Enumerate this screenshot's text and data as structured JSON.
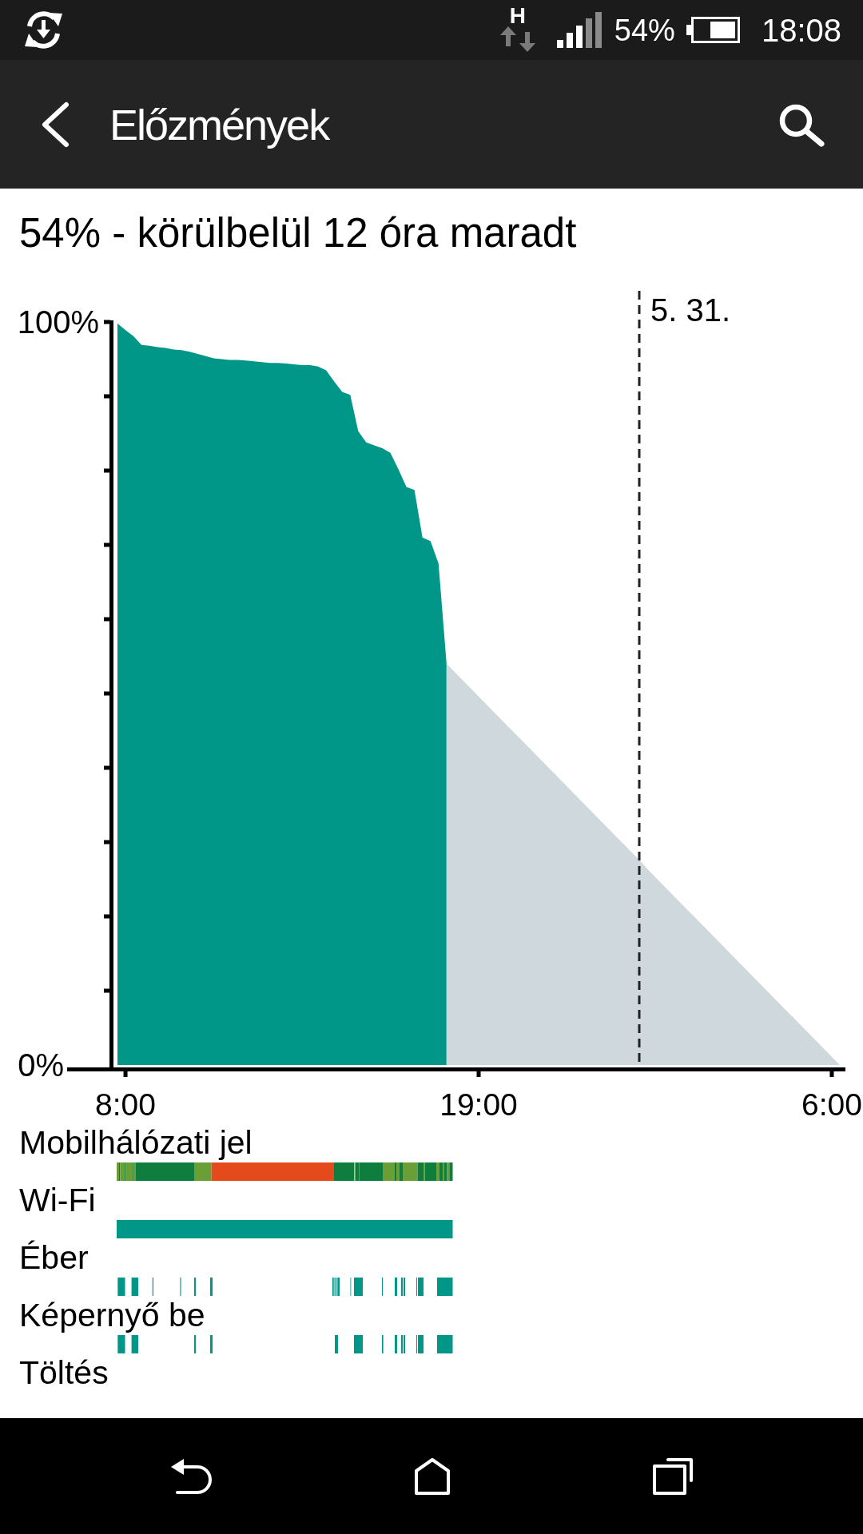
{
  "status_bar": {
    "network_type": "H",
    "battery": "54%",
    "time": "18:08"
  },
  "app_bar": {
    "title": "Előzmények"
  },
  "summary": "54% - körülbelül 12 óra maradt",
  "chart": {
    "chart_data": {
      "type": "area",
      "categories": [
        null,
        "8:00",
        null,
        null,
        null,
        null,
        null,
        null,
        null,
        null,
        null,
        null,
        null,
        null,
        null,
        null,
        null,
        null,
        null,
        null,
        null,
        null,
        null,
        null,
        null,
        null,
        null,
        null,
        null,
        null,
        null,
        null,
        null,
        null,
        null,
        null,
        null,
        null,
        null,
        null,
        null,
        null,
        null,
        null,
        null,
        "19:00",
        null,
        null,
        null,
        null,
        null,
        null,
        null,
        null,
        null,
        null,
        null,
        null,
        null,
        null,
        null,
        null,
        null,
        null,
        null,
        null,
        null,
        null,
        null,
        null,
        null,
        null,
        null,
        null,
        null,
        null,
        null,
        null,
        null,
        null,
        null,
        null,
        null,
        null,
        null,
        null,
        null,
        null,
        null,
        "6:00",
        null
      ],
      "series": [
        {
          "color": "#009688",
          "values": [
            99.8,
            98.9,
            98.1,
            96.9,
            96.8,
            96.6,
            96.5,
            96.3,
            96.2,
            96.0,
            95.7,
            95.4,
            95.1,
            95.0,
            94.9,
            94.9,
            94.8,
            94.7,
            94.6,
            94.5,
            94.5,
            94.4,
            94.3,
            94.2,
            94.2,
            94.0,
            93.5,
            92.0,
            90.6,
            90.2,
            85.3,
            83.8,
            83.4,
            83.0,
            82.4,
            80.2,
            77.8,
            77.4,
            71.0,
            70.5,
            67.5,
            54.0,
            null,
            null,
            null,
            null,
            null,
            null,
            null,
            null,
            null,
            null,
            null,
            null,
            null,
            null,
            null,
            null,
            null,
            null,
            null,
            null,
            null,
            null,
            null,
            null,
            null,
            null,
            null,
            null,
            null,
            null,
            null,
            null,
            null,
            null,
            null,
            null,
            null,
            null,
            null,
            null,
            null,
            null,
            null,
            null,
            null,
            null,
            null,
            null,
            null
          ]
        },
        {
          "color": "#cfd8dc",
          "values": [
            null,
            null,
            null,
            null,
            null,
            null,
            null,
            null,
            null,
            null,
            null,
            null,
            null,
            null,
            null,
            null,
            null,
            null,
            null,
            null,
            null,
            null,
            null,
            null,
            null,
            null,
            null,
            null,
            null,
            null,
            null,
            null,
            null,
            null,
            null,
            null,
            null,
            null,
            null,
            null,
            null,
            54.0,
            52.9,
            51.8,
            50.7,
            49.6,
            48.5,
            47.4,
            46.3,
            45.2,
            44.1,
            43.0,
            41.9,
            40.8,
            39.7,
            38.6,
            37.5,
            36.4,
            35.3,
            34.2,
            33.1,
            32.0,
            30.9,
            29.8,
            28.7,
            27.6,
            26.4,
            25.3,
            24.2,
            23.1,
            22.0,
            20.9,
            19.8,
            18.7,
            17.6,
            16.5,
            15.4,
            14.3,
            13.2,
            12.1,
            11.0,
            9.9,
            8.8,
            7.7,
            6.6,
            5.5,
            4.4,
            3.3,
            2.2,
            1.1,
            0.0
          ]
        }
      ],
      "ylim": [
        0,
        100
      ],
      "yticks": [
        {
          "value": 0,
          "label": "0%"
        },
        {
          "value": 100,
          "label": "100%"
        }
      ],
      "annotations": [
        "5. 31."
      ]
    }
  },
  "tracks": [
    {
      "kind": "signal",
      "label": "Mobilhálózati jel"
    },
    {
      "kind": "wifi",
      "label": "Wi-Fi"
    },
    {
      "kind": "awake",
      "label": "Éber"
    },
    {
      "kind": "screen",
      "label": "Képernyő be"
    },
    {
      "kind": "charging",
      "label": "Töltés"
    }
  ]
}
